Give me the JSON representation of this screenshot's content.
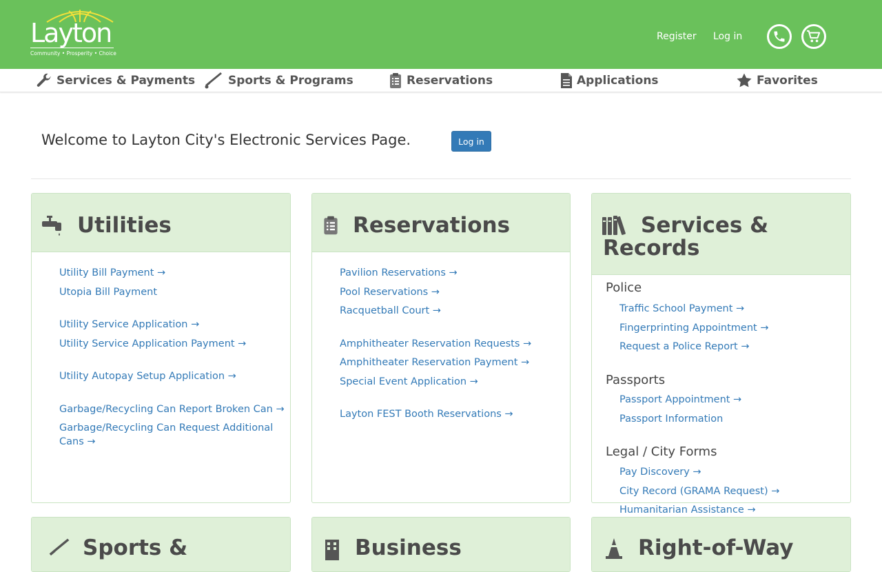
{
  "brand": {
    "logo_text": "Layton",
    "tagline": "Community • Prosperity • Choice",
    "color_primary": "#6ac15b",
    "color_link": "#337ab7"
  },
  "header": {
    "register_label": "Register",
    "login_label": "Log in",
    "phone_icon": "phone-icon",
    "cart_icon": "cart-icon"
  },
  "nav": {
    "items": [
      {
        "label": "Services & Payments",
        "icon": "wrench-icon"
      },
      {
        "label": "Sports & Programs",
        "icon": "bat-icon"
      },
      {
        "label": "Reservations",
        "icon": "clipboard-icon"
      },
      {
        "label": "Applications",
        "icon": "document-icon"
      },
      {
        "label": "Favorites",
        "icon": "star-icon"
      }
    ]
  },
  "welcome": {
    "text": "Welcome to Layton City's Electronic Services Page.",
    "login_button": "Log in"
  },
  "panels": {
    "utilities": {
      "title": "Utilities",
      "icon": "faucet-icon",
      "links": [
        "Utility Bill Payment →",
        "Utopia Bill Payment",
        "Utility Service Application →",
        "Utility Service Application Payment →",
        "Utility Autopay Setup Application →",
        "Garbage/Recycling Can Report Broken Can →",
        "Garbage/Recycling Can Request Additional",
        "Cans →"
      ]
    },
    "reservations": {
      "title": "Reservations",
      "icon": "clipboard-icon",
      "links": [
        "Pavilion Reservations →",
        "Pool Reservations →",
        "Racquetball Court →",
        "Amphitheater Reservation Requests →",
        "Amphitheater Reservation Payment →",
        "Special Event Application →",
        "Layton FEST Booth Reservations →"
      ]
    },
    "services_records": {
      "title_line1": "Services &",
      "title_line2": "Records",
      "icon": "books-icon",
      "sections": [
        {
          "heading": "Police",
          "links": [
            "Traffic School Payment →",
            "Fingerprinting Appointment →",
            "Request a Police Report →"
          ]
        },
        {
          "heading": "Passports",
          "links": [
            "Passport Appointment →",
            "Passport Information"
          ]
        },
        {
          "heading": "Legal / City Forms",
          "links": [
            "Pay Discovery →",
            "City Record (GRAMA Request) →",
            "Humanitarian Assistance →"
          ]
        }
      ]
    },
    "sports": {
      "title": "Sports &",
      "icon": "bat-icon"
    },
    "business": {
      "title": "Business",
      "icon": "building-icon"
    },
    "row": {
      "title": "Right-of-Way",
      "icon": "cone-icon"
    }
  }
}
